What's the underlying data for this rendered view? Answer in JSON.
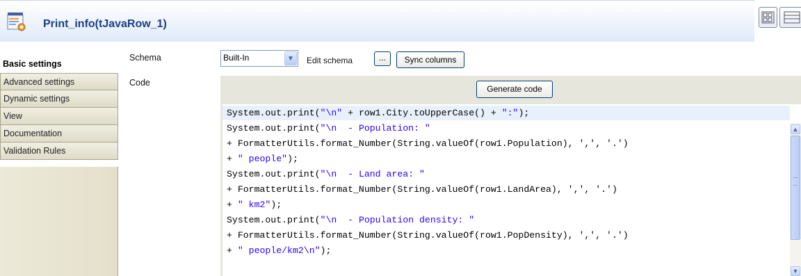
{
  "header": {
    "title": "Print_info(tJavaRow_1)",
    "icon": "component-icon",
    "view_buttons": [
      "grid-view-icon",
      "list-view-icon"
    ]
  },
  "tabs": [
    {
      "label": "Basic settings",
      "active": true
    },
    {
      "label": "Advanced settings",
      "active": false
    },
    {
      "label": "Dynamic settings",
      "active": false
    },
    {
      "label": "View",
      "active": false
    },
    {
      "label": "Documentation",
      "active": false
    },
    {
      "label": "Validation Rules",
      "active": false
    }
  ],
  "schema": {
    "label": "Schema",
    "value": "Built-In",
    "edit_label": "Edit schema",
    "ellipsis": "...",
    "sync_label": "Sync columns"
  },
  "code": {
    "label": "Code",
    "generate_label": "Generate code",
    "lines": [
      "System.out.print(\"\\n\" + row1.City.toUpperCase() + \":\");",
      "System.out.print(\"\\n  - Population: \"",
      "+ FormatterUtils.format_Number(String.valueOf(row1.Population), ',', '.')",
      "+ \" people\");",
      "System.out.print(\"\\n  - Land area: \"",
      "+ FormatterUtils.format_Number(String.valueOf(row1.LandArea), ',', '.')",
      "+ \" km2\");",
      "System.out.print(\"\\n  - Population density: \"",
      "+ FormatterUtils.format_Number(String.valueOf(row1.PopDensity), ',', '.')",
      "+ \" people/km2\\n\");"
    ]
  },
  "colors": {
    "title": "#1a3e87",
    "string_literal": "#2a00ff",
    "code_background": "#e7e6dc"
  }
}
